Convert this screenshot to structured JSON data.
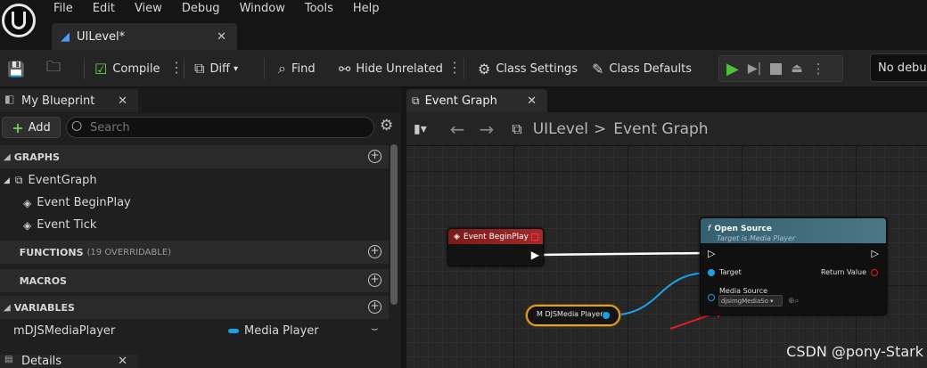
{
  "menu": [
    "File",
    "Edit",
    "View",
    "Debug",
    "Window",
    "Tools",
    "Help"
  ],
  "document_tab": {
    "label": "UILevel*"
  },
  "toolbar": {
    "compile": "Compile",
    "diff": "Diff",
    "find": "Find",
    "hide_unrelated": "Hide Unrelated",
    "class_settings": "Class Settings",
    "class_defaults": "Class Defaults",
    "debug_select": "No debug"
  },
  "my_blueprint": {
    "tab_label": "My Blueprint",
    "add_label": "Add",
    "search_placeholder": "Search",
    "sections": {
      "graphs": "GRAPHS",
      "functions": "FUNCTIONS",
      "functions_sub": "(19 OVERRIDABLE)",
      "macros": "MACROS",
      "variables": "VARIABLES"
    },
    "graphs": [
      "EventGraph",
      "Event BeginPlay",
      "Event Tick"
    ],
    "variable": {
      "name": "mDJSMediaPlayer",
      "type": "Media Player"
    }
  },
  "details_tab": {
    "label": "Details"
  },
  "graph": {
    "tab_label": "Event Graph",
    "breadcrumb_root": "UILevel",
    "breadcrumb_sep": ">",
    "breadcrumb_leaf": "Event Graph",
    "nodes": {
      "begin_play": "Event BeginPlay",
      "open_source_title": "Open Source",
      "open_source_subtitle": "Target is Media Player",
      "target_label": "Target",
      "return_label": "Return Value",
      "media_source_label": "Media Source",
      "media_source_value": "djsimgMediaSo",
      "variable_node": "M DJSMedia Player"
    }
  },
  "watermark": "CSDN @pony-Stark",
  "colors": {
    "event_header": "#a32a2a",
    "function_header": "#4a7686",
    "object_pin": "#1aa0e6",
    "exec_wire": "#ffffff",
    "variable_border": "#e0a030",
    "play_green": "#4cc43a",
    "annotation_arrow": "#e02020"
  }
}
